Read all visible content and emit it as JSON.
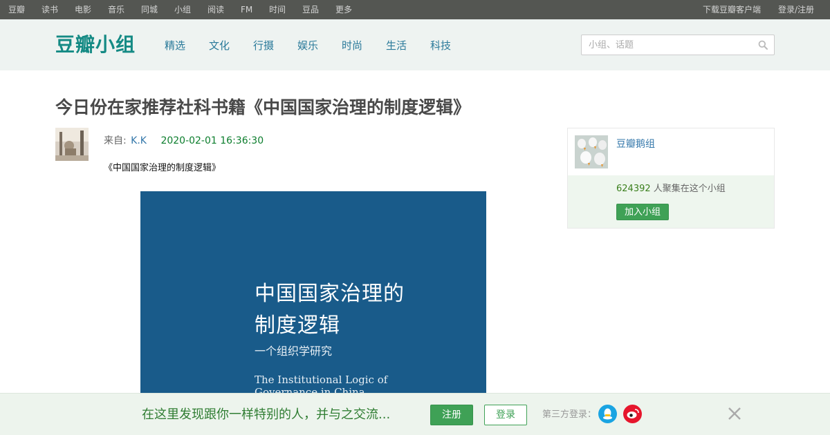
{
  "global_nav": {
    "left": [
      "豆瓣",
      "读书",
      "电影",
      "音乐",
      "同城",
      "小组",
      "阅读",
      "FM",
      "时间",
      "豆品",
      "更多"
    ],
    "download": "下载豆瓣客户端",
    "login_register": "登录/注册"
  },
  "header": {
    "logo": "豆瓣小组",
    "categories": [
      "精选",
      "文化",
      "行摄",
      "娱乐",
      "时尚",
      "生活",
      "科技"
    ],
    "search_placeholder": "小组、话题"
  },
  "topic": {
    "title": "今日份在家推荐社科书籍《中国国家治理的制度逻辑》",
    "from_label": "来自:",
    "author": "K.K",
    "time": "2020-02-01 16:36:30",
    "book_line": "《中国国家治理的制度逻辑》",
    "cover": {
      "title_line1": "中国国家治理的",
      "title_line2": "制度逻辑",
      "subtitle": "一个组织学研究",
      "en_line1": "The Institutional Logic of",
      "en_line2": "Governance in China"
    }
  },
  "group": {
    "name": "豆瓣鹅组",
    "member_count": "624392",
    "member_text": "人聚集在这个小组",
    "join_label": "加入小组"
  },
  "promo": {
    "slogan": "在这里发现跟你一样特别的人，并与之交流...",
    "register": "注册",
    "login": "登录",
    "third_party": "第三方登录："
  },
  "colors": {
    "nav_bg": "#545652",
    "header_bg": "#eef3f1",
    "logo": "#148a84",
    "green_button": "#3fa156",
    "cover_blue": "#195b8a"
  }
}
